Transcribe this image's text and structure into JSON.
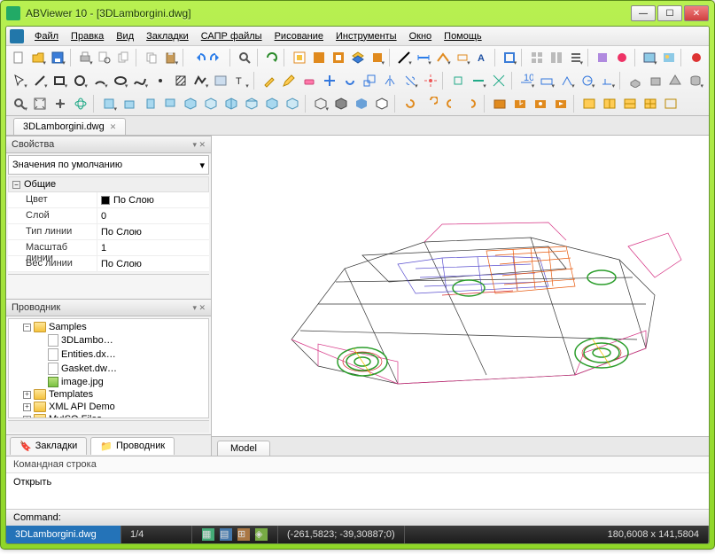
{
  "window": {
    "title": "ABViewer 10 - [3DLamborgini.dwg]"
  },
  "menu": {
    "file": "Файл",
    "edit": "Правка",
    "view": "Вид",
    "bookmarks": "Закладки",
    "cadfiles": "САПР файлы",
    "drawing": "Рисование",
    "tools": "Инструменты",
    "window": "Окно",
    "help": "Помощь"
  },
  "doc_tab": {
    "name": "3DLamborgini.dwg"
  },
  "properties": {
    "header": "Свойства",
    "combo": "Значения по умолчанию",
    "category": "Общие",
    "rows": {
      "color": {
        "k": "Цвет",
        "v": "По Слою"
      },
      "layer": {
        "k": "Слой",
        "v": "0"
      },
      "linetype": {
        "k": "Тип линии",
        "v": "По Слою"
      },
      "ltscale": {
        "k": "Масштаб линии",
        "v": "1"
      },
      "lweight": {
        "k": "Вес линии",
        "v": "По Слою"
      }
    }
  },
  "explorer": {
    "header": "Проводник",
    "tree": {
      "samples": "Samples",
      "files": [
        "3DLambo…",
        "Entities.dx…",
        "Gasket.dw…",
        "image.jpg"
      ],
      "templates": "Templates",
      "xmlapi": "XML API Demo",
      "myiso": "MyISO Files"
    }
  },
  "side_tabs": {
    "bookmarks": "Закладки",
    "explorer": "Проводник"
  },
  "view_tab": "Model",
  "commandline": {
    "label": "Командная строка",
    "value": "Открыть",
    "prompt": "Command:"
  },
  "statusbar": {
    "file": "3DLamborgini.dwg",
    "page": "1/4",
    "coords": "(-261,5823; -39,30887;0)",
    "size": "180,6008 x 141,5804"
  },
  "colors": {
    "accent": "#2473b8"
  }
}
